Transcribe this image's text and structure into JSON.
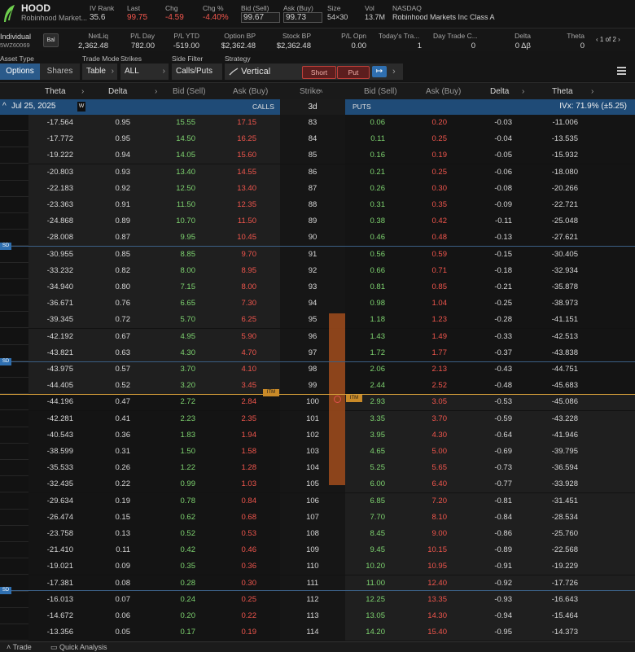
{
  "header": {
    "symbol": "HOOD",
    "company_short": "Robinhood Market...",
    "iv_rank_label": "IV Rank",
    "iv_rank": "35.6",
    "last_label": "Last",
    "last": "99.75",
    "chg_label": "Chg",
    "chg": "-4.59",
    "chg_pct_label": "Chg %",
    "chg_pct": "-4.40%",
    "bid_label": "Bid (Sell)",
    "bid": "99.67",
    "ask_label": "Ask (Buy)",
    "ask": "99.73",
    "size_label": "Size",
    "size": "54×30",
    "vol_label": "Vol",
    "vol": "13.7M",
    "exchange": "NASDAQ",
    "company_full": "Robinhood Markets Inc Class A"
  },
  "account": {
    "type": "Individual",
    "id": "5WZ60069",
    "bal_button": "Bal",
    "netliq_label": "NetLiq",
    "netliq": "2,362.48",
    "pl_day_label": "P/L Day",
    "pl_day": "782.00",
    "pl_ytd_label": "P/L YTD",
    "pl_ytd": "-519.00",
    "option_bp_label": "Option BP",
    "option_bp": "$2,362.48",
    "stock_bp_label": "Stock BP",
    "stock_bp": "$2,362.48",
    "pl_open_label": "P/L Opn",
    "pl_open": "0.00",
    "todays_trades_label": "Today's Tra...",
    "todays_trades": "1",
    "day_trade_label": "Day Trade C...",
    "day_trade": "0",
    "delta_label": "Delta",
    "delta": "0 Δβ",
    "theta_label": "Theta",
    "theta": "0",
    "pager": "1 of 2"
  },
  "filters": {
    "asset_type_label": "Asset Type",
    "options_tab": "Options",
    "shares_tab": "Shares",
    "trade_mode_label": "Trade Mode",
    "trade_mode": "Table",
    "strikes_label": "Strikes",
    "strikes": "ALL",
    "side_filter_label": "Side Filter",
    "side_filter": "Calls/Puts",
    "strategy_label": "Strategy",
    "strategy": "Vertical",
    "short_button": "Short",
    "put_button": "Put"
  },
  "columns": {
    "theta": "Theta",
    "delta": "Delta",
    "bid": "Bid (Sell)",
    "ask": "Ask (Buy)",
    "strike": "Strike",
    "put_bid": "Bid (Sell)",
    "put_ask": "Ask (Buy)",
    "put_delta": "Delta",
    "put_theta": "Theta"
  },
  "expiry": {
    "date": "Jul 25, 2025",
    "weekly_badge": "W",
    "calls_label": "CALLS",
    "days": "3d",
    "puts_label": "PUTS",
    "ivx": "IVx: 71.9% (±5.25)"
  },
  "markers": {
    "itm": "ITM",
    "sd": "SD"
  },
  "rows": [
    {
      "ct": "-17.564",
      "cd": "0.95",
      "cb": "15.55",
      "ca": "17.15",
      "k": "83",
      "pb": "0.06",
      "pa": "0.20",
      "pd": "-0.03",
      "pt": "-11.006"
    },
    {
      "ct": "-17.772",
      "cd": "0.95",
      "cb": "14.50",
      "ca": "16.25",
      "k": "84",
      "pb": "0.11",
      "pa": "0.25",
      "pd": "-0.04",
      "pt": "-13.535"
    },
    {
      "ct": "-19.222",
      "cd": "0.94",
      "cb": "14.05",
      "ca": "15.60",
      "k": "85",
      "pb": "0.16",
      "pa": "0.19",
      "pd": "-0.05",
      "pt": "-15.932"
    },
    {
      "ct": "-20.803",
      "cd": "0.93",
      "cb": "13.40",
      "ca": "14.55",
      "k": "86",
      "pb": "0.21",
      "pa": "0.25",
      "pd": "-0.06",
      "pt": "-18.080"
    },
    {
      "ct": "-22.183",
      "cd": "0.92",
      "cb": "12.50",
      "ca": "13.40",
      "k": "87",
      "pb": "0.26",
      "pa": "0.30",
      "pd": "-0.08",
      "pt": "-20.266"
    },
    {
      "ct": "-23.363",
      "cd": "0.91",
      "cb": "11.50",
      "ca": "12.35",
      "k": "88",
      "pb": "0.31",
      "pa": "0.35",
      "pd": "-0.09",
      "pt": "-22.721"
    },
    {
      "ct": "-24.868",
      "cd": "0.89",
      "cb": "10.70",
      "ca": "11.50",
      "k": "89",
      "pb": "0.38",
      "pa": "0.42",
      "pd": "-0.11",
      "pt": "-25.048"
    },
    {
      "ct": "-28.008",
      "cd": "0.87",
      "cb": "9.95",
      "ca": "10.45",
      "k": "90",
      "pb": "0.46",
      "pa": "0.48",
      "pd": "-0.13",
      "pt": "-27.621"
    },
    {
      "ct": "-30.955",
      "cd": "0.85",
      "cb": "8.85",
      "ca": "9.70",
      "k": "91",
      "pb": "0.56",
      "pa": "0.59",
      "pd": "-0.15",
      "pt": "-30.405"
    },
    {
      "ct": "-33.232",
      "cd": "0.82",
      "cb": "8.00",
      "ca": "8.95",
      "k": "92",
      "pb": "0.66",
      "pa": "0.71",
      "pd": "-0.18",
      "pt": "-32.934"
    },
    {
      "ct": "-34.940",
      "cd": "0.80",
      "cb": "7.15",
      "ca": "8.00",
      "k": "93",
      "pb": "0.81",
      "pa": "0.85",
      "pd": "-0.21",
      "pt": "-35.878"
    },
    {
      "ct": "-36.671",
      "cd": "0.76",
      "cb": "6.65",
      "ca": "7.30",
      "k": "94",
      "pb": "0.98",
      "pa": "1.04",
      "pd": "-0.25",
      "pt": "-38.973"
    },
    {
      "ct": "-39.345",
      "cd": "0.72",
      "cb": "5.70",
      "ca": "6.25",
      "k": "95",
      "pb": "1.18",
      "pa": "1.23",
      "pd": "-0.28",
      "pt": "-41.151"
    },
    {
      "ct": "-42.192",
      "cd": "0.67",
      "cb": "4.95",
      "ca": "5.90",
      "k": "96",
      "pb": "1.43",
      "pa": "1.49",
      "pd": "-0.33",
      "pt": "-42.513"
    },
    {
      "ct": "-43.821",
      "cd": "0.63",
      "cb": "4.30",
      "ca": "4.70",
      "k": "97",
      "pb": "1.72",
      "pa": "1.77",
      "pd": "-0.37",
      "pt": "-43.838"
    },
    {
      "ct": "-43.975",
      "cd": "0.57",
      "cb": "3.70",
      "ca": "4.10",
      "k": "98",
      "pb": "2.06",
      "pa": "2.13",
      "pd": "-0.43",
      "pt": "-44.751"
    },
    {
      "ct": "-44.405",
      "cd": "0.52",
      "cb": "3.20",
      "ca": "3.45",
      "k": "99",
      "pb": "2.44",
      "pa": "2.52",
      "pd": "-0.48",
      "pt": "-45.683"
    },
    {
      "ct": "-44.196",
      "cd": "0.47",
      "cb": "2.72",
      "ca": "2.84",
      "k": "100",
      "pb": "2.93",
      "pa": "3.05",
      "pd": "-0.53",
      "pt": "-45.086"
    },
    {
      "ct": "-42.281",
      "cd": "0.41",
      "cb": "2.23",
      "ca": "2.35",
      "k": "101",
      "pb": "3.35",
      "pa": "3.70",
      "pd": "-0.59",
      "pt": "-43.228"
    },
    {
      "ct": "-40.543",
      "cd": "0.36",
      "cb": "1.83",
      "ca": "1.94",
      "k": "102",
      "pb": "3.95",
      "pa": "4.30",
      "pd": "-0.64",
      "pt": "-41.946"
    },
    {
      "ct": "-38.599",
      "cd": "0.31",
      "cb": "1.50",
      "ca": "1.58",
      "k": "103",
      "pb": "4.65",
      "pa": "5.00",
      "pd": "-0.69",
      "pt": "-39.795"
    },
    {
      "ct": "-35.533",
      "cd": "0.26",
      "cb": "1.22",
      "ca": "1.28",
      "k": "104",
      "pb": "5.25",
      "pa": "5.65",
      "pd": "-0.73",
      "pt": "-36.594"
    },
    {
      "ct": "-32.435",
      "cd": "0.22",
      "cb": "0.99",
      "ca": "1.03",
      "k": "105",
      "pb": "6.00",
      "pa": "6.40",
      "pd": "-0.77",
      "pt": "-33.928"
    },
    {
      "ct": "-29.634",
      "cd": "0.19",
      "cb": "0.78",
      "ca": "0.84",
      "k": "106",
      "pb": "6.85",
      "pa": "7.20",
      "pd": "-0.81",
      "pt": "-31.451"
    },
    {
      "ct": "-26.474",
      "cd": "0.15",
      "cb": "0.62",
      "ca": "0.68",
      "k": "107",
      "pb": "7.70",
      "pa": "8.10",
      "pd": "-0.84",
      "pt": "-28.534"
    },
    {
      "ct": "-23.758",
      "cd": "0.13",
      "cb": "0.52",
      "ca": "0.53",
      "k": "108",
      "pb": "8.45",
      "pa": "9.00",
      "pd": "-0.86",
      "pt": "-25.760"
    },
    {
      "ct": "-21.410",
      "cd": "0.11",
      "cb": "0.42",
      "ca": "0.46",
      "k": "109",
      "pb": "9.45",
      "pa": "10.15",
      "pd": "-0.89",
      "pt": "-22.568"
    },
    {
      "ct": "-19.021",
      "cd": "0.09",
      "cb": "0.35",
      "ca": "0.36",
      "k": "110",
      "pb": "10.20",
      "pa": "10.95",
      "pd": "-0.91",
      "pt": "-19.229"
    },
    {
      "ct": "-17.381",
      "cd": "0.08",
      "cb": "0.28",
      "ca": "0.30",
      "k": "111",
      "pb": "11.00",
      "pa": "12.40",
      "pd": "-0.92",
      "pt": "-17.726"
    },
    {
      "ct": "-16.013",
      "cd": "0.07",
      "cb": "0.24",
      "ca": "0.25",
      "k": "112",
      "pb": "12.25",
      "pa": "13.35",
      "pd": "-0.93",
      "pt": "-16.643"
    },
    {
      "ct": "-14.672",
      "cd": "0.06",
      "cb": "0.20",
      "ca": "0.22",
      "k": "113",
      "pb": "13.05",
      "pa": "14.30",
      "pd": "-0.94",
      "pt": "-15.464"
    },
    {
      "ct": "-13.356",
      "cd": "0.05",
      "cb": "0.17",
      "ca": "0.19",
      "k": "114",
      "pb": "14.20",
      "pa": "15.40",
      "pd": "-0.95",
      "pt": "-14.373"
    }
  ],
  "footer": {
    "trade_tab": "Trade",
    "quick_analysis_tab": "Quick Analysis"
  },
  "colors": {
    "green": "#7ed470",
    "red": "#f2564d",
    "accent": "#2f6fb0",
    "itm_bar": "#b4541d"
  }
}
